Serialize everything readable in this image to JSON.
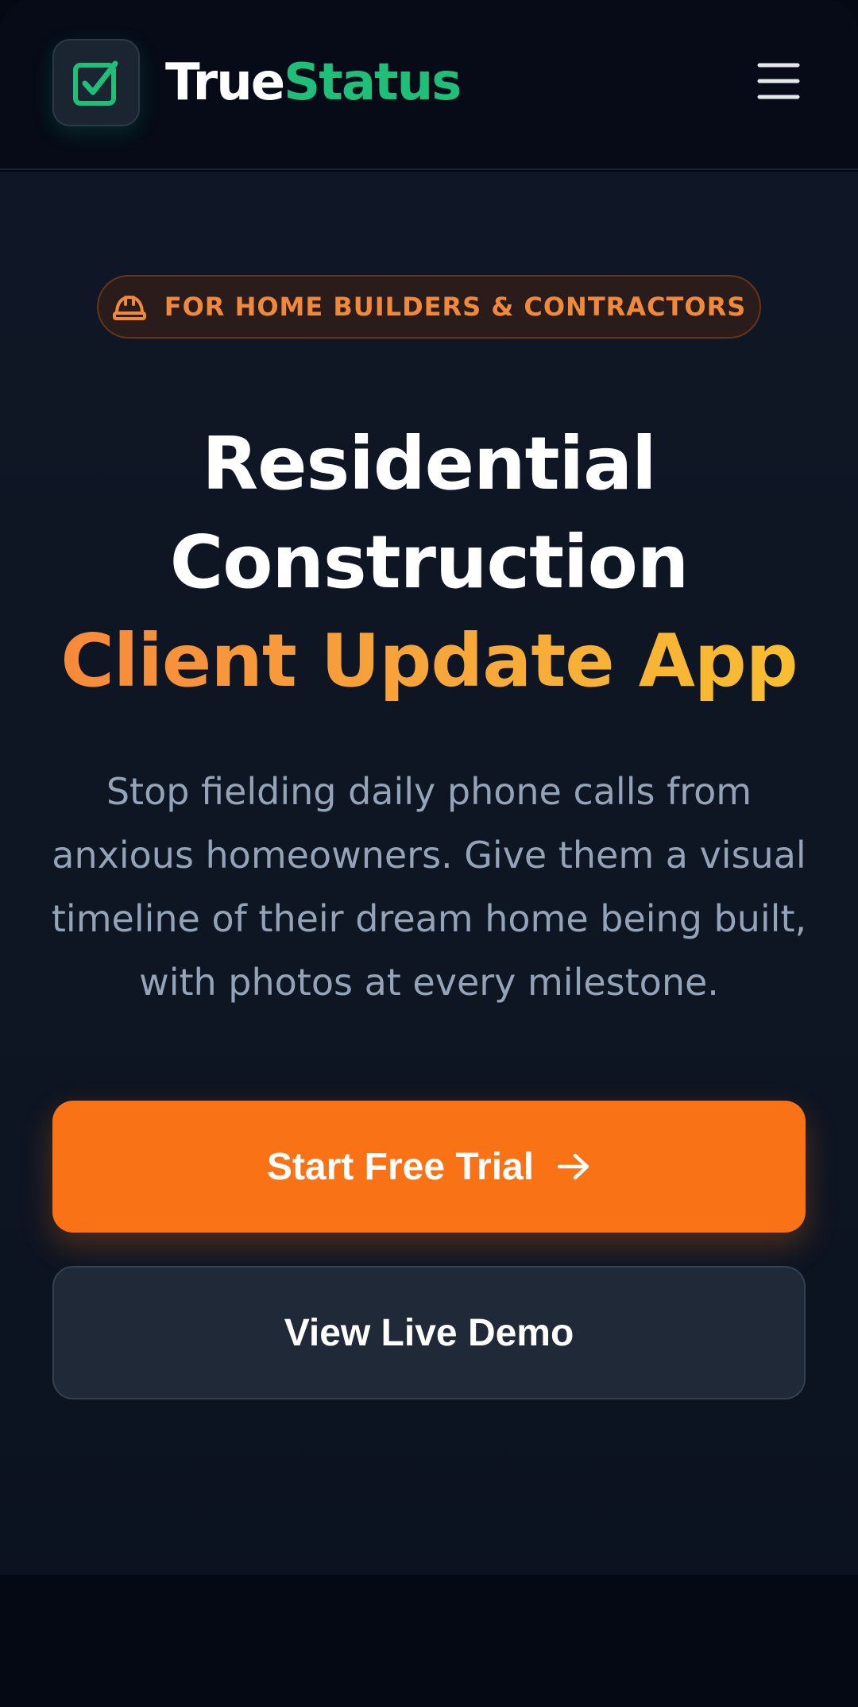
{
  "header": {
    "brand_part1": "True",
    "brand_part2": "Status",
    "logo_icon": "checkbox-check-icon",
    "menu_icon": "hamburger-menu-icon"
  },
  "hero": {
    "badge": {
      "icon": "hard-hat-icon",
      "text": "FOR HOME BUILDERS & CONTRACTORS"
    },
    "title_line1": "Residential",
    "title_line2": "Construction",
    "title_accent": "Client Update App",
    "subtitle": "Stop fielding daily phone calls from anxious homeowners. Give them a visual timeline of their dream home being built, with photos at every milestone.",
    "primary_button": {
      "label": "Start Free Trial",
      "icon": "arrow-right-icon"
    },
    "secondary_button": {
      "label": "View Live Demo"
    }
  },
  "colors": {
    "background": "#050914",
    "accent_orange": "#f97316",
    "accent_green": "#1fbf7a",
    "badge_text": "#f08a3a",
    "accent_gradient_end": "#f9c22e"
  }
}
